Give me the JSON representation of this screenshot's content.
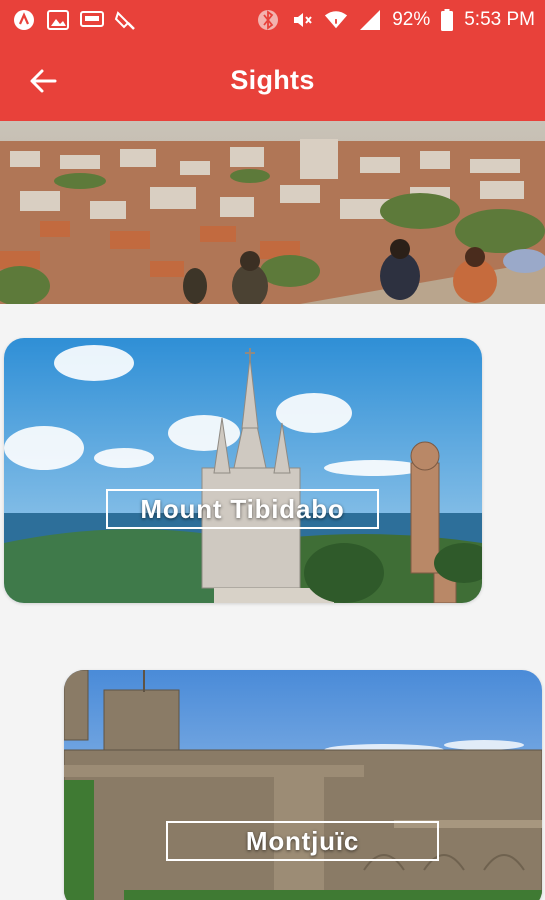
{
  "status_bar": {
    "battery_percent": "92%",
    "time": "5:53 PM",
    "left_icons": [
      "app-icon",
      "image-icon",
      "hd-icon",
      "bluetooth-icon"
    ],
    "right_icons": [
      "vibrate-icon",
      "mute-icon",
      "wifi-icon",
      "signal-icon",
      "battery-icon"
    ]
  },
  "app_bar": {
    "title": "Sights",
    "back_icon": "arrow-left-icon",
    "background": "#e8413a"
  },
  "hero": {
    "image": "barcelona-city-view"
  },
  "sights": [
    {
      "name": "Mount Tibidabo"
    },
    {
      "name": "Montjuïc"
    }
  ],
  "colors": {
    "accent": "#e8413a",
    "background": "#f4f4f4",
    "label_text": "#ffffff"
  }
}
